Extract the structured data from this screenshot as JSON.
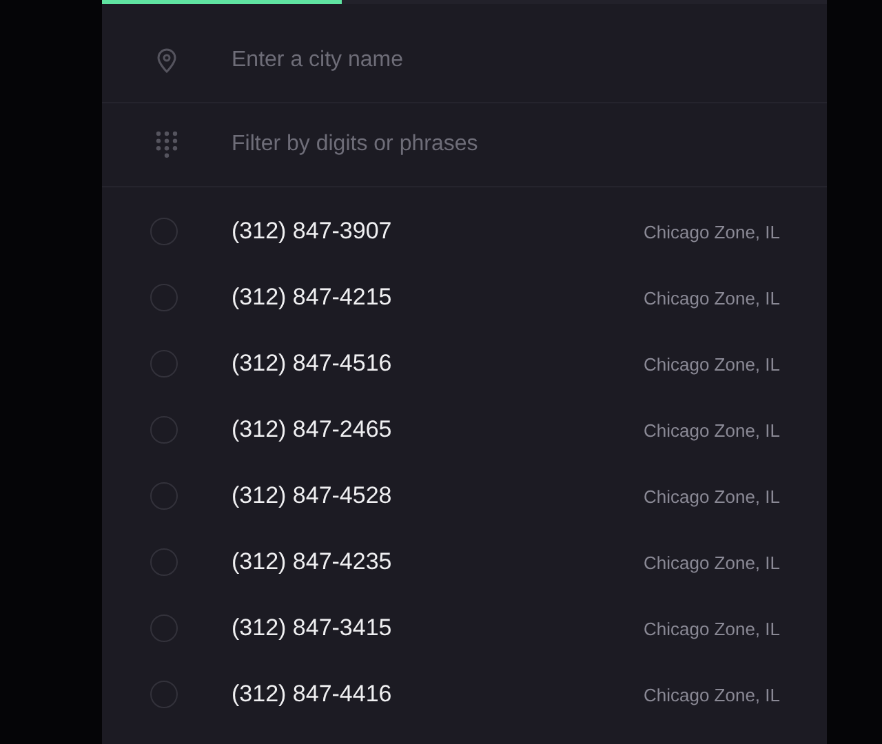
{
  "progress": {
    "level": 0.33
  },
  "city_field": {
    "placeholder": "Enter a city name"
  },
  "filter_field": {
    "placeholder": "Filter by digits or phrases"
  },
  "numbers": [
    {
      "number": "(312) 847-3907",
      "region": "Chicago Zone, IL",
      "selected": false
    },
    {
      "number": "(312) 847-4215",
      "region": "Chicago Zone, IL",
      "selected": false
    },
    {
      "number": "(312) 847-4516",
      "region": "Chicago Zone, IL",
      "selected": false
    },
    {
      "number": "(312) 847-2465",
      "region": "Chicago Zone, IL",
      "selected": false
    },
    {
      "number": "(312) 847-4528",
      "region": "Chicago Zone, IL",
      "selected": false
    },
    {
      "number": "(312) 847-4235",
      "region": "Chicago Zone, IL",
      "selected": false
    },
    {
      "number": "(312) 847-3415",
      "region": "Chicago Zone, IL",
      "selected": false
    },
    {
      "number": "(312) 847-4416",
      "region": "Chicago Zone, IL",
      "selected": false
    }
  ]
}
